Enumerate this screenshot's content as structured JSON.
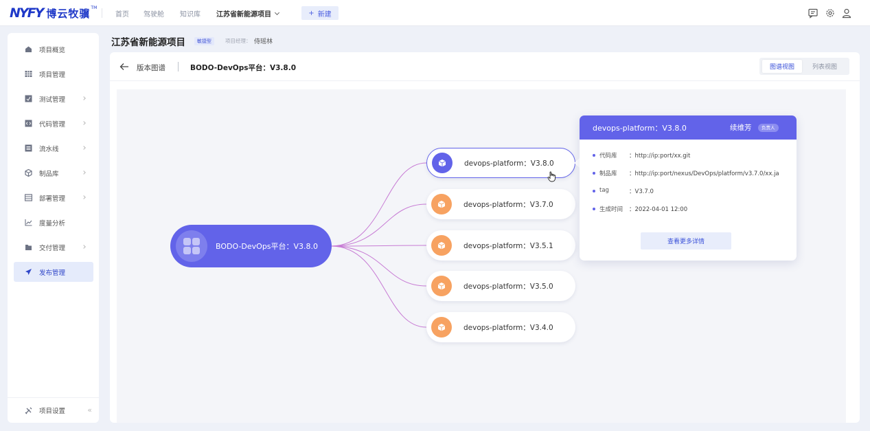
{
  "topbar": {
    "logo_mark": "NYFY",
    "logo_name": "博云牧骥",
    "logo_tm": "TM",
    "nav": [
      "首页",
      "驾驶舱",
      "知识库"
    ],
    "current_project": "江苏省新能源项目",
    "new_button": "新建",
    "icons": [
      "message-icon",
      "settings-icon",
      "user-icon"
    ]
  },
  "sidebar": {
    "items": [
      {
        "label": "项目概览",
        "icon": "home-icon",
        "arrow": false,
        "active": false
      },
      {
        "label": "项目管理",
        "icon": "grid-icon",
        "arrow": false,
        "active": false
      },
      {
        "label": "测试管理",
        "icon": "test-icon",
        "arrow": true,
        "active": false
      },
      {
        "label": "代码管理",
        "icon": "code-icon",
        "arrow": true,
        "active": false
      },
      {
        "label": "流水线",
        "icon": "pipeline-icon",
        "arrow": true,
        "active": false
      },
      {
        "label": "制品库",
        "icon": "package-icon",
        "arrow": true,
        "active": false
      },
      {
        "label": "部署管理",
        "icon": "deploy-icon",
        "arrow": true,
        "active": false
      },
      {
        "label": "度量分析",
        "icon": "chart-icon",
        "arrow": false,
        "active": false
      },
      {
        "label": "交付管理",
        "icon": "delivery-icon",
        "arrow": true,
        "active": false
      },
      {
        "label": "发布管理",
        "icon": "send-icon",
        "arrow": false,
        "active": true
      }
    ],
    "settings_label": "项目设置",
    "collapse_glyph": "«"
  },
  "header": {
    "project_title": "江苏省新能源项目",
    "project_type": "敏捷型",
    "manager_label": "项目经理：",
    "manager_name": "侍瑶林"
  },
  "panel": {
    "back_label": "版本图谱",
    "current": "BODO-DevOps平台：V3.8.0",
    "views": [
      "图谱视图",
      "列表视图"
    ],
    "active_view": "图谱视图"
  },
  "graph": {
    "root": "BODO-DevOps平台：V3.8.0",
    "versions": [
      {
        "label": "devops-platform：V3.8.0",
        "selected": true
      },
      {
        "label": "devops-platform：V3.7.0",
        "selected": false
      },
      {
        "label": "devops-platform：V3.5.1",
        "selected": false
      },
      {
        "label": "devops-platform：V3.5.0",
        "selected": false
      },
      {
        "label": "devops-platform：V3.4.0",
        "selected": false
      }
    ]
  },
  "detail_card": {
    "title": "devops-platform：V3.8.0",
    "owner": "续维芳",
    "owner_role": "负责人",
    "rows": [
      {
        "key": "代码库",
        "value": "：http://ip:port/xx.git"
      },
      {
        "key": "制品库",
        "value": "：http://ip:port/nexus/DevOps/platform/v3.7.0/xx.ja"
      },
      {
        "key": "tag",
        "value": "：V3.7.0"
      },
      {
        "key": "生成时间",
        "value": "：2022-04-01 12:00"
      }
    ],
    "more_button": "查看更多详情"
  },
  "colors": {
    "primary": "#6263e9",
    "orange": "#f7a261",
    "brand": "#1e38c8"
  }
}
